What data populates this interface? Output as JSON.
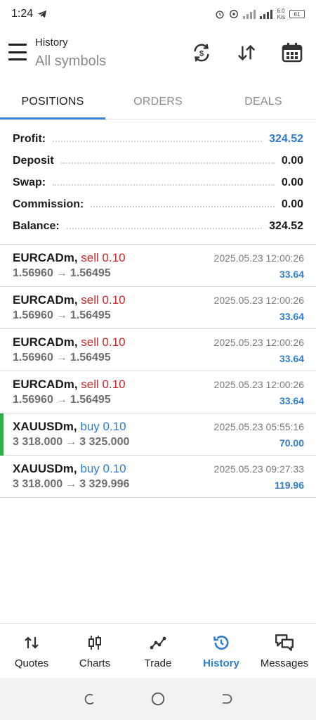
{
  "status_bar": {
    "time": "1:24",
    "net_speed_top": "6.0",
    "net_speed_bottom": "K/s",
    "network": "4G",
    "battery": "61"
  },
  "app_bar": {
    "title": "History",
    "subtitle": "All symbols",
    "icons": [
      "menu-icon",
      "currency-exchange-icon",
      "sort-icon",
      "calendar-icon"
    ]
  },
  "tabs": [
    {
      "label": "POSITIONS",
      "active": true
    },
    {
      "label": "ORDERS",
      "active": false
    },
    {
      "label": "DEALS",
      "active": false
    }
  ],
  "summary": [
    {
      "label": "Profit:",
      "value": "324.52",
      "highlight": true
    },
    {
      "label": "Deposit",
      "value": "0.00",
      "highlight": false
    },
    {
      "label": "Swap:",
      "value": "0.00",
      "highlight": false
    },
    {
      "label": "Commission:",
      "value": "0.00",
      "highlight": false
    },
    {
      "label": "Balance:",
      "value": "324.52",
      "highlight": false
    }
  ],
  "positions": [
    {
      "symbol": "EURCADm,",
      "side": "sell 0.10",
      "type": "sell",
      "open": "1.56960",
      "close": "1.56495",
      "time": "2025.05.23 12:00:26",
      "profit": "33.64",
      "marker": false
    },
    {
      "symbol": "EURCADm,",
      "side": "sell 0.10",
      "type": "sell",
      "open": "1.56960",
      "close": "1.56495",
      "time": "2025.05.23 12:00:26",
      "profit": "33.64",
      "marker": false
    },
    {
      "symbol": "EURCADm,",
      "side": "sell 0.10",
      "type": "sell",
      "open": "1.56960",
      "close": "1.56495",
      "time": "2025.05.23 12:00:26",
      "profit": "33.64",
      "marker": false
    },
    {
      "symbol": "EURCADm,",
      "side": "sell 0.10",
      "type": "sell",
      "open": "1.56960",
      "close": "1.56495",
      "time": "2025.05.23 12:00:26",
      "profit": "33.64",
      "marker": false
    },
    {
      "symbol": "XAUUSDm,",
      "side": "buy 0.10",
      "type": "buy",
      "open": "3 318.000",
      "close": "3 325.000",
      "time": "2025.05.23 05:55:16",
      "profit": "70.00",
      "marker": true
    },
    {
      "symbol": "XAUUSDm,",
      "side": "buy 0.10",
      "type": "buy",
      "open": "3 318.000",
      "close": "3 329.996",
      "time": "2025.05.23 09:27:33",
      "profit": "119.96",
      "marker": false
    }
  ],
  "bottom_nav": [
    {
      "label": "Quotes",
      "icon": "quotes-icon",
      "active": false
    },
    {
      "label": "Charts",
      "icon": "charts-icon",
      "active": false
    },
    {
      "label": "Trade",
      "icon": "trade-icon",
      "active": false
    },
    {
      "label": "History",
      "icon": "history-icon",
      "active": true
    },
    {
      "label": "Messages",
      "icon": "messages-icon",
      "active": false
    }
  ],
  "colors": {
    "accent": "#2f7dd1",
    "sell": "#c9262a",
    "buy": "#2f7dd1",
    "marker": "#2fae4a"
  }
}
